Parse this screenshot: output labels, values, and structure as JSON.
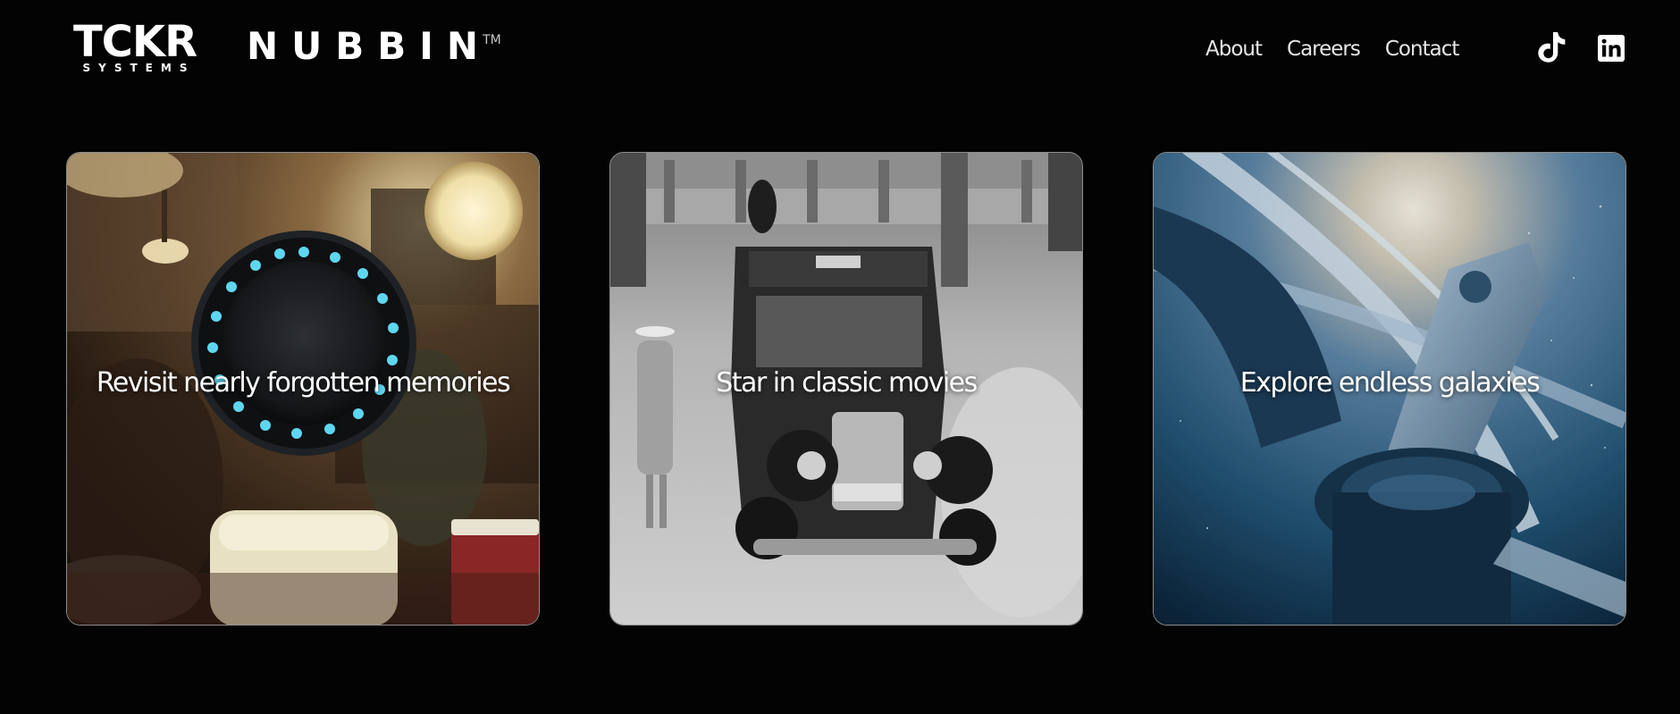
{
  "brand": {
    "company_logo": "TCKR",
    "company_logo_sub": "SYSTEMS",
    "product_name": "NUBBIN",
    "trademark": "TM"
  },
  "nav": {
    "items": [
      {
        "label": "About"
      },
      {
        "label": "Careers"
      },
      {
        "label": "Contact"
      }
    ]
  },
  "social": [
    {
      "icon": "tiktok-icon"
    },
    {
      "icon": "linkedin-icon"
    }
  ],
  "cards": [
    {
      "caption": "Revisit nearly forgotten memories",
      "scene": "vintage-party-with-device"
    },
    {
      "caption": "Star in classic movies",
      "scene": "black-and-white-vintage-taxi"
    },
    {
      "caption": "Explore endless galaxies",
      "scene": "space-station"
    }
  ],
  "colors": {
    "background": "#030303",
    "text": "#ffffff",
    "nav_text": "#e6e6e6",
    "device_glow": "#5fd6f0"
  }
}
